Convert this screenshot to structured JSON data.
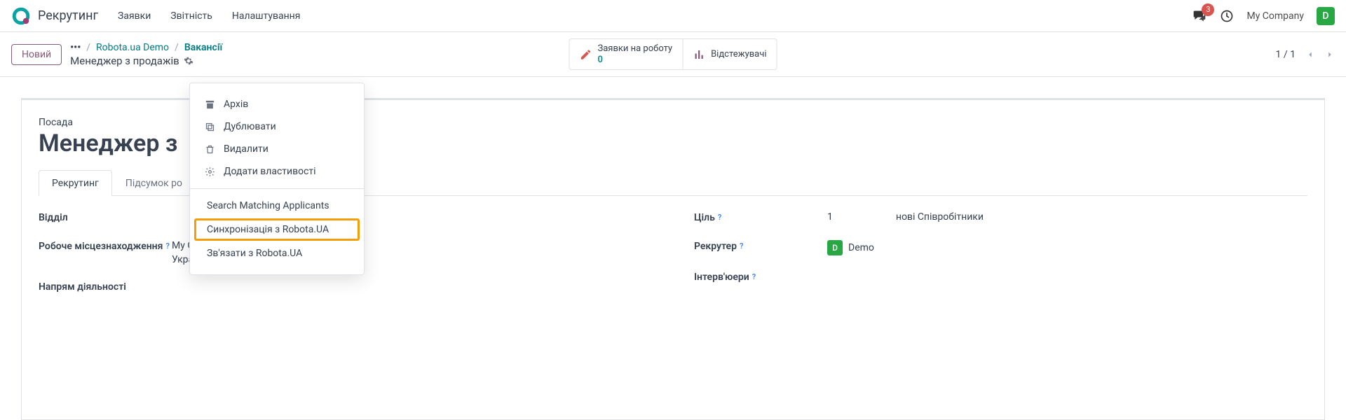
{
  "navbar": {
    "brand": "Рекрутинг",
    "links": [
      "Заявки",
      "Звітність",
      "Налаштування"
    ],
    "badge": "3",
    "company": "My Company",
    "avatar_letter": "D"
  },
  "control": {
    "new_btn": "Новий",
    "bc_link1": "Robota.ua Demo",
    "bc_link2": "Вакансії",
    "bc_title": "Менеджер з продажів",
    "smart1_label": "Заявки на роботу",
    "smart1_count": "0",
    "smart2_label": "Відстежувачі",
    "pager": "1 / 1"
  },
  "sheet": {
    "position_label": "Посада",
    "title": "Менеджер з",
    "tab1": "Рекрутинг",
    "tab2": "Підсумок ро",
    "left": {
      "department": "Відділ",
      "location": "Робоче місцезнаходження",
      "location_v1": "My Company",
      "location_v2": "Україна",
      "industry": "Напрям діяльності"
    },
    "right": {
      "target": "Ціль",
      "target_val": "1",
      "target_text": "нові Співробітники",
      "recruiter": "Рекрутер",
      "recruiter_avatar": "D",
      "recruiter_val": "Demo",
      "interviewers": "Інтерв'юери"
    }
  },
  "dropdown": {
    "archive": "Архів",
    "duplicate": "Дублювати",
    "delete": "Видалити",
    "add_props": "Додати властивості",
    "search_match": "Search Matching Applicants",
    "sync": "Синхронізація з Robota.UA",
    "link": "Зв'язати з Robota.UA"
  }
}
